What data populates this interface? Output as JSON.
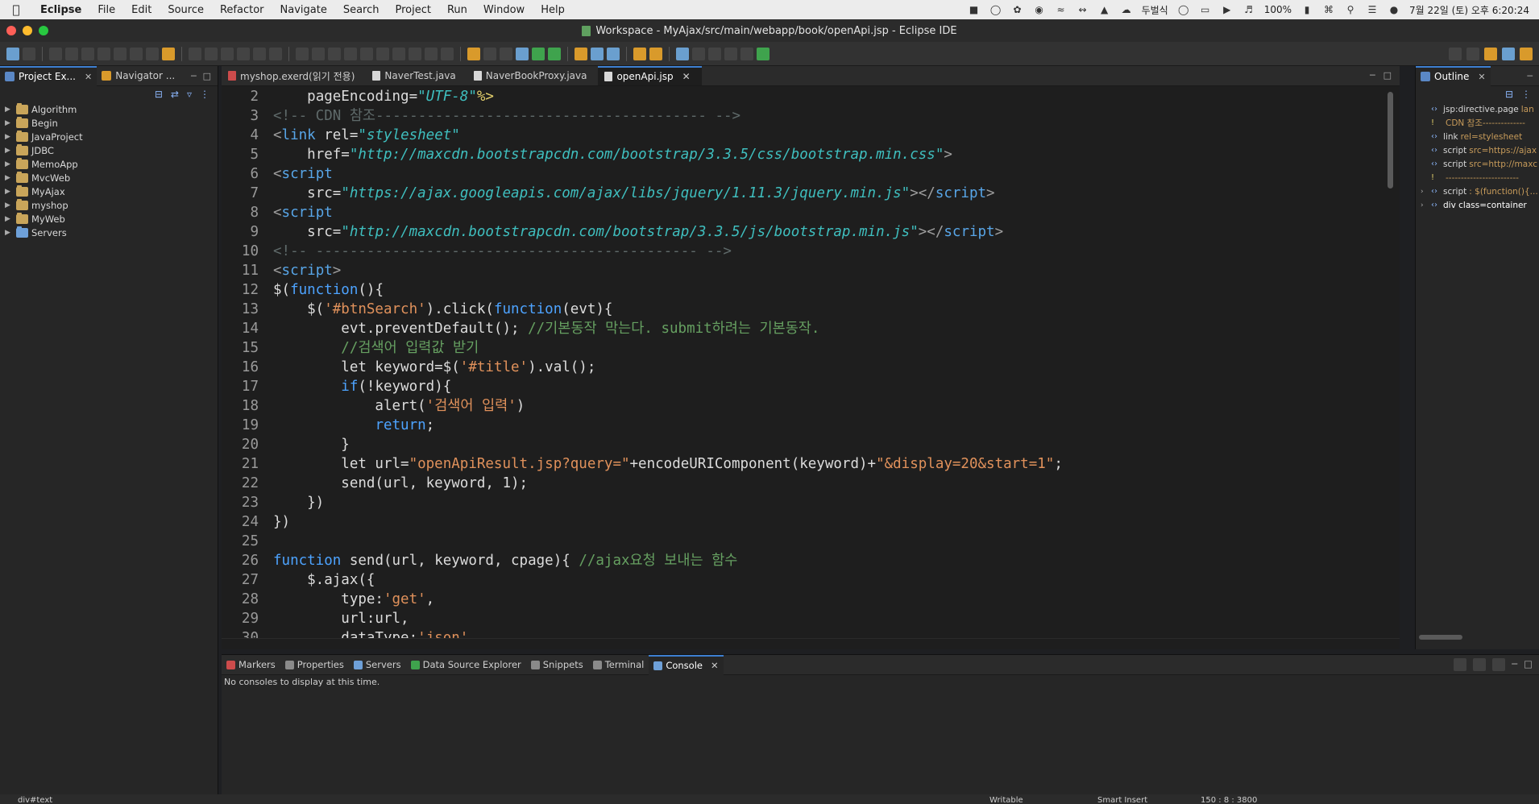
{
  "menubar": {
    "app": "Eclipse",
    "items": [
      "File",
      "Edit",
      "Source",
      "Refactor",
      "Navigate",
      "Search",
      "Project",
      "Run",
      "Window",
      "Help"
    ],
    "weather": "두벌식",
    "battery": "100%",
    "clock": "7월 22일 (토) 오후 6:20:24"
  },
  "window": {
    "title": "Workspace - MyAjax/src/main/webapp/book/openApi.jsp - Eclipse IDE"
  },
  "left_panel": {
    "tabs": [
      {
        "label": "Project Ex..."
      },
      {
        "label": "Navigator ..."
      }
    ],
    "projects": [
      "Algorithm",
      "Begin",
      "JavaProject",
      "JDBC",
      "MemoApp",
      "MvcWeb",
      "MyAjax",
      "myshop",
      "MyWeb",
      "Servers"
    ]
  },
  "editor": {
    "tabs": [
      {
        "label": "myshop.exerd(읽기 전용)"
      },
      {
        "label": "NaverTest.java"
      },
      {
        "label": "NaverBookProxy.java"
      },
      {
        "label": "openApi.jsp"
      }
    ],
    "lines": [
      {
        "n": "2",
        "parts": [
          [
            "",
            "    "
          ],
          [
            "tk-attr",
            "pageEncoding="
          ],
          [
            "tk-str",
            "\"UTF-8\""
          ],
          [
            "tk-dir",
            "%>"
          ]
        ]
      },
      {
        "n": "3",
        "parts": [
          [
            "tk-com",
            "<!-- CDN 참조--------------------------------------- -->"
          ]
        ]
      },
      {
        "n": "4",
        "parts": [
          [
            "tk-ang",
            "<"
          ],
          [
            "tk-tag",
            "link "
          ],
          [
            "tk-attr",
            "rel="
          ],
          [
            "tk-str",
            "\"stylesheet\""
          ]
        ]
      },
      {
        "n": "5",
        "parts": [
          [
            "",
            "    "
          ],
          [
            "tk-attr",
            "href="
          ],
          [
            "tk-str",
            "\"http://maxcdn.bootstrapcdn.com/bootstrap/3.3.5/css/bootstrap.min.css\""
          ],
          [
            "tk-ang",
            ">"
          ]
        ]
      },
      {
        "n": "6",
        "fold": true,
        "parts": [
          [
            "tk-ang",
            "<"
          ],
          [
            "tk-tag",
            "script"
          ]
        ]
      },
      {
        "n": "7",
        "parts": [
          [
            "",
            "    "
          ],
          [
            "tk-attr",
            "src="
          ],
          [
            "tk-str",
            "\"https://ajax.googleapis.com/ajax/libs/jquery/1.11.3/jquery.min.js\""
          ],
          [
            "tk-ang",
            "></"
          ],
          [
            "tk-tag",
            "script"
          ],
          [
            "tk-ang",
            ">"
          ]
        ]
      },
      {
        "n": "8",
        "fold": true,
        "parts": [
          [
            "tk-ang",
            "<"
          ],
          [
            "tk-tag",
            "script"
          ]
        ]
      },
      {
        "n": "9",
        "parts": [
          [
            "",
            "    "
          ],
          [
            "tk-attr",
            "src="
          ],
          [
            "tk-str",
            "\"http://maxcdn.bootstrapcdn.com/bootstrap/3.3.5/js/bootstrap.min.js\""
          ],
          [
            "tk-ang",
            "></"
          ],
          [
            "tk-tag",
            "script"
          ],
          [
            "tk-ang",
            ">"
          ]
        ]
      },
      {
        "n": "10",
        "parts": [
          [
            "tk-com",
            "<!-- --------------------------------------------- -->"
          ]
        ]
      },
      {
        "n": "11",
        "fold": true,
        "parts": [
          [
            "tk-ang",
            "<"
          ],
          [
            "tk-tag",
            "script"
          ],
          [
            "tk-ang",
            ">"
          ]
        ]
      },
      {
        "n": "12",
        "parts": [
          [
            "",
            "$("
          ],
          [
            "tk-kw",
            "function"
          ],
          [
            "",
            "(){"
          ]
        ]
      },
      {
        "n": "13",
        "parts": [
          [
            "",
            "    $("
          ],
          [
            "tk-js-str",
            "'#btnSearch'"
          ],
          [
            "",
            ").click("
          ],
          [
            "tk-kw",
            "function"
          ],
          [
            "",
            "(evt){"
          ]
        ]
      },
      {
        "n": "14",
        "parts": [
          [
            "",
            "        evt.preventDefault(); "
          ],
          [
            "tk-jcom",
            "//기본동작 막는다. submit하려는 기본동작."
          ]
        ]
      },
      {
        "n": "15",
        "parts": [
          [
            "",
            "        "
          ],
          [
            "tk-jcom",
            "//검색어 입력값 받기"
          ]
        ]
      },
      {
        "n": "16",
        "parts": [
          [
            "",
            "        let keyword=$("
          ],
          [
            "tk-js-str",
            "'#title'"
          ],
          [
            "",
            ").val();"
          ]
        ]
      },
      {
        "n": "17",
        "parts": [
          [
            "",
            "        "
          ],
          [
            "tk-kw",
            "if"
          ],
          [
            "",
            "(!keyword){"
          ]
        ]
      },
      {
        "n": "18",
        "parts": [
          [
            "",
            "            alert("
          ],
          [
            "tk-js-str",
            "'검색어 입력'"
          ],
          [
            "",
            ")"
          ]
        ]
      },
      {
        "n": "19",
        "parts": [
          [
            "",
            "            "
          ],
          [
            "tk-kw",
            "return"
          ],
          [
            "",
            ";"
          ]
        ]
      },
      {
        "n": "20",
        "parts": [
          [
            "",
            "        }"
          ]
        ]
      },
      {
        "n": "21",
        "parts": [
          [
            "",
            "        let url="
          ],
          [
            "tk-js-str",
            "\"openApiResult.jsp?query=\""
          ],
          [
            "",
            "+encodeURIComponent(keyword)+"
          ],
          [
            "tk-js-str",
            "\"&display=20&start=1\""
          ],
          [
            "",
            ";"
          ]
        ]
      },
      {
        "n": "22",
        "parts": [
          [
            "",
            "        send(url, keyword, 1);"
          ]
        ]
      },
      {
        "n": "23",
        "parts": [
          [
            "",
            "    })"
          ]
        ]
      },
      {
        "n": "24",
        "parts": [
          [
            "",
            "})"
          ]
        ]
      },
      {
        "n": "25",
        "parts": [
          [
            "",
            ""
          ]
        ]
      },
      {
        "n": "26",
        "parts": [
          [
            "tk-kw",
            "function"
          ],
          [
            "",
            " send(url, keyword, cpage){ "
          ],
          [
            "tk-jcom",
            "//ajax요청 보내는 함수"
          ]
        ]
      },
      {
        "n": "27",
        "parts": [
          [
            "",
            "    $.ajax({"
          ]
        ]
      },
      {
        "n": "28",
        "parts": [
          [
            "",
            "        type:"
          ],
          [
            "tk-js-str",
            "'get'"
          ],
          [
            "",
            ","
          ]
        ]
      },
      {
        "n": "29",
        "parts": [
          [
            "",
            "        url:url,"
          ]
        ]
      },
      {
        "n": "30",
        "parts": [
          [
            "",
            "        dataType:"
          ],
          [
            "tk-js-str",
            "'json'"
          ],
          [
            "",
            ","
          ]
        ]
      }
    ]
  },
  "outline": {
    "tab": "Outline",
    "items": [
      {
        "main": "jsp:directive.page",
        "dim": " lan",
        "icon": "tag"
      },
      {
        "main": "",
        "dim": "CDN 참조--------------",
        "icon": "warn"
      },
      {
        "main": "link",
        "dim": " rel=stylesheet",
        "icon": "tag"
      },
      {
        "main": "script",
        "dim": " src=https://ajax",
        "icon": "tag"
      },
      {
        "main": "script",
        "dim": " src=http://maxc",
        "icon": "tag"
      },
      {
        "main": "",
        "dim": "------------------------",
        "icon": "warn"
      },
      {
        "main": "script",
        "dim": " : $(function(){...",
        "icon": "tag",
        "expandable": true
      },
      {
        "main": "div class=container",
        "dim": "",
        "icon": "tag",
        "expandable": true,
        "strong": true
      }
    ]
  },
  "bottom": {
    "tabs": [
      "Markers",
      "Properties",
      "Servers",
      "Data Source Explorer",
      "Snippets",
      "Terminal",
      "Console"
    ],
    "message": "No consoles to display at this time."
  },
  "status": {
    "left": "div#text",
    "mode": "Writable",
    "insert": "Smart Insert",
    "pos": "150 : 8 : 3800"
  }
}
